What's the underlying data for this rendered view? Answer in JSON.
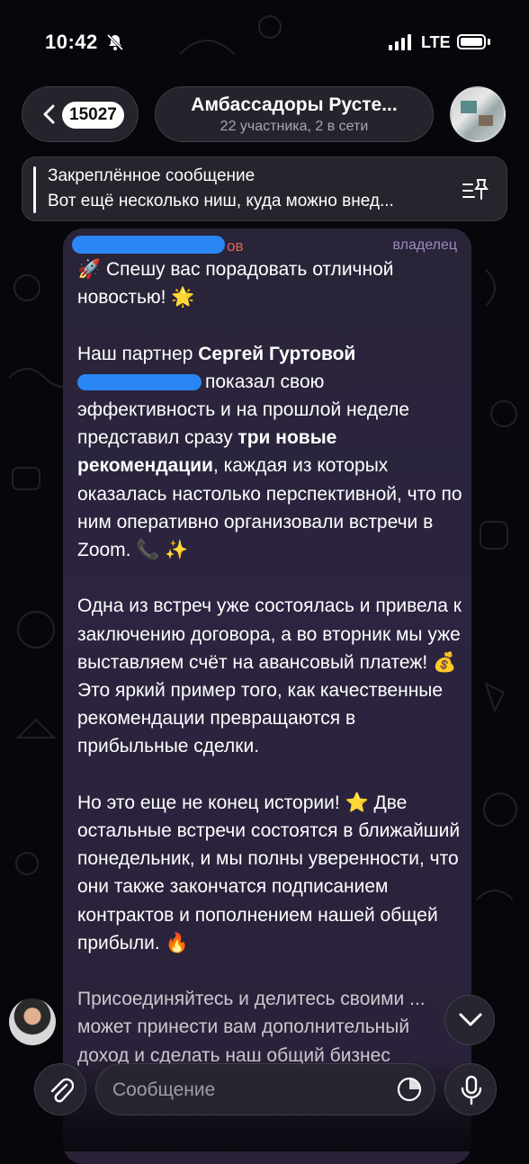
{
  "status_bar": {
    "time": "10:42",
    "network": "LTE",
    "icons": [
      "bell-slash-icon",
      "signal-icon",
      "battery-icon"
    ]
  },
  "header": {
    "back_badge": "15027",
    "title": "Амбассадоры Русте...",
    "subtitle": "22 участника, 2 в сети"
  },
  "pinned": {
    "title": "Закреплённое сообщение",
    "text": "Вот ещё несколько ниш, куда можно внед..."
  },
  "message": {
    "sender_suffix": "ов",
    "role": "владелец",
    "p1": "🚀 Спешу вас порадовать отличной новостью! 🌟",
    "p2_intro": "Наш партнер ",
    "p2_name": "Сергей Гуртовой",
    "p2_a": "показал свою эффективность и на прошлой неделе представил сразу ",
    "p2_bold": "три новые рекомендации",
    "p2_b": ", каждая из которых оказалась настолько перспективной, что по ним оперативно организовали встречи в Zoom. 📞 ✨",
    "p3": "Одна из встреч уже состоялась и привела к заключению договора, а во вторник мы уже выставляем счёт на авансовый платеж! 💰 Это яркий пример того, как качественные рекомендации превращаются в прибыльные сделки.",
    "p4": "Но это еще не конец истории! ⭐ Две остальные встречи состоятся в ближайший понедельник, и мы полны уверенности, что они также закончатся подписанием контрактов и пополнением нашей общей прибыли. 🔥",
    "p5": "Присоединяйтесь и делитесь своими ... может принести вам дополнительный доход и сделать наш общий бизнес"
  },
  "input": {
    "placeholder": "Сообщение"
  }
}
